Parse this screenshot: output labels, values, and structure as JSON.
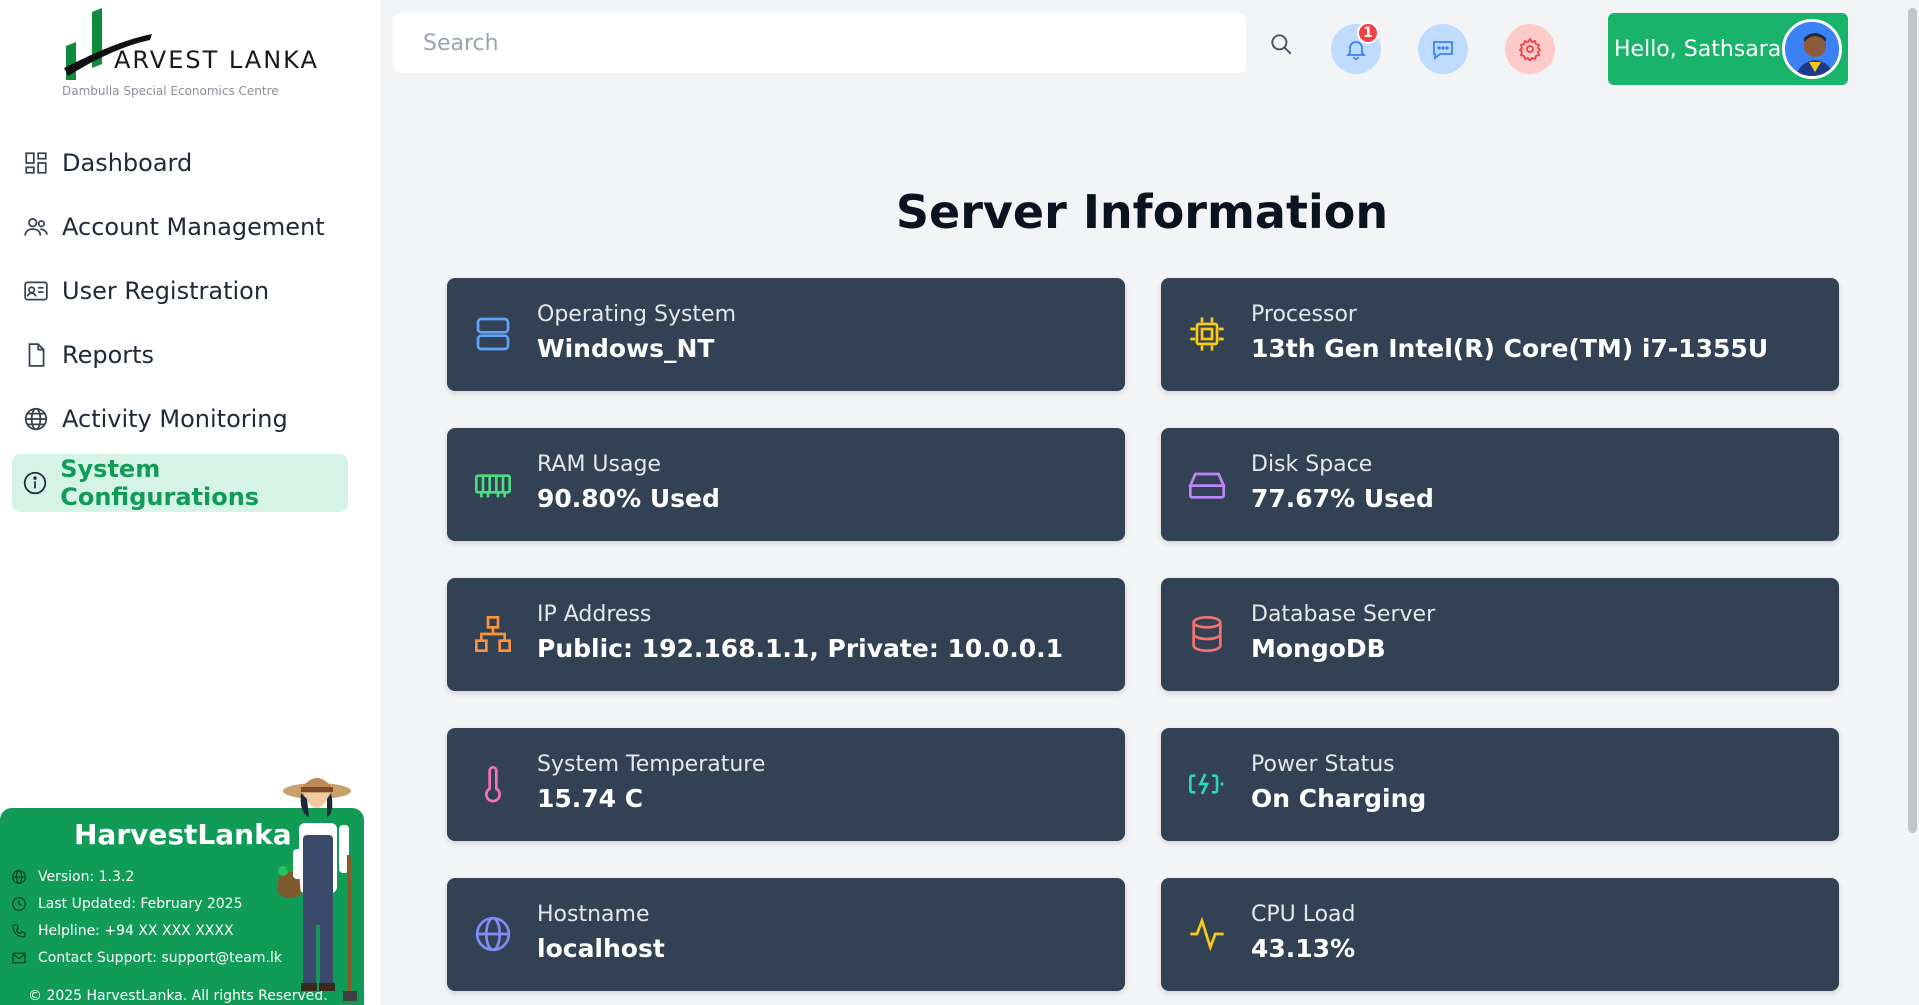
{
  "logo": {
    "brand_initial": "H",
    "brand_rest": "ARVEST LANKA",
    "subtitle": "Dambulla Special Economics Centre"
  },
  "sidebar": {
    "items": [
      {
        "label": "Dashboard",
        "icon": "dashboard-icon",
        "active": false
      },
      {
        "label": "Account Management",
        "icon": "users-icon",
        "active": false
      },
      {
        "label": "User Registration",
        "icon": "id-card-icon",
        "active": false
      },
      {
        "label": "Reports",
        "icon": "document-icon",
        "active": false
      },
      {
        "label": "Activity Monitoring",
        "icon": "globe-icon",
        "active": false
      },
      {
        "label": "System Configurations",
        "icon": "info-icon",
        "active": true
      }
    ]
  },
  "footer": {
    "title": "HarvestLanka",
    "version": "Version: 1.3.2",
    "last_updated": "Last Updated: February 2025",
    "helpline": "Helpline: +94 XX XXX XXXX",
    "contact": "Contact Support: support@team.lk",
    "copyright": "© 2025 HarvestLanka. All rights Reserved."
  },
  "header": {
    "search_placeholder": "Search",
    "notification_count": "1",
    "greeting": "Hello, Sathsara"
  },
  "main": {
    "title": "Server Information",
    "cards": [
      {
        "label": "Operating System",
        "value": "Windows_NT",
        "icon": "server-icon",
        "color": "#60a5fa"
      },
      {
        "label": "Processor",
        "value": "13th Gen Intel(R) Core(TM) i7-1355U",
        "icon": "cpu-icon",
        "color": "#facc15"
      },
      {
        "label": "RAM Usage",
        "value": "90.80% Used",
        "icon": "memory-icon",
        "color": "#4ade80"
      },
      {
        "label": "Disk Space",
        "value": "77.67% Used",
        "icon": "hard-drive-icon",
        "color": "#c084fc"
      },
      {
        "label": "IP Address",
        "value": "Public: 192.168.1.1, Private: 10.0.0.1",
        "icon": "network-icon",
        "color": "#fb923c"
      },
      {
        "label": "Database Server",
        "value": "MongoDB",
        "icon": "database-icon",
        "color": "#f87171"
      },
      {
        "label": "System Temperature",
        "value": "15.74 C",
        "icon": "thermometer-icon",
        "color": "#f472b6"
      },
      {
        "label": "Power Status",
        "value": "On Charging",
        "icon": "battery-charging-icon",
        "color": "#2dd4bf"
      },
      {
        "label": "Hostname",
        "value": "localhost",
        "icon": "globe-icon",
        "color": "#818cf8"
      },
      {
        "label": "CPU Load",
        "value": "43.13%",
        "icon": "activity-icon",
        "color": "#facc15"
      }
    ]
  },
  "colors": {
    "accent": "#109c57",
    "card_bg": "#334155",
    "user_button": "#19b36b"
  }
}
